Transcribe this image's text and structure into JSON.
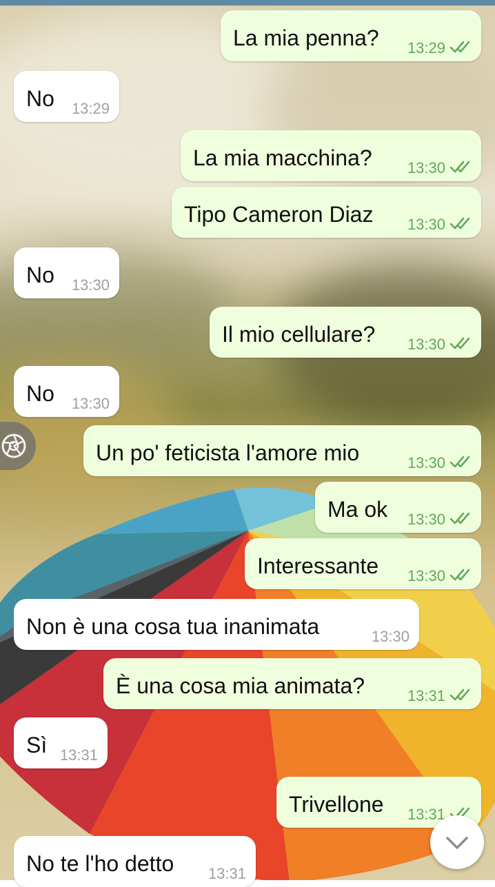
{
  "chat": {
    "background_image": "rainbow-umbrella-wallpaper",
    "messages": [
      {
        "direction": "out",
        "text": "La mia penna?",
        "time": "13:29",
        "status": "read"
      },
      {
        "direction": "in",
        "text": "No",
        "time": "13:29"
      },
      {
        "direction": "out",
        "text": "La mia macchina?",
        "time": "13:30",
        "status": "read"
      },
      {
        "direction": "out",
        "text": "Tipo Cameron Diaz",
        "time": "13:30",
        "status": "read"
      },
      {
        "direction": "in",
        "text": "No",
        "time": "13:30"
      },
      {
        "direction": "out",
        "text": "Il mio cellulare?",
        "time": "13:30",
        "status": "read"
      },
      {
        "direction": "in",
        "text": "No",
        "time": "13:30"
      },
      {
        "direction": "out",
        "text": "Un po' feticista l'amore mio",
        "time": "13:30",
        "status": "read"
      },
      {
        "direction": "out",
        "text": "Ma ok",
        "time": "13:30",
        "status": "read"
      },
      {
        "direction": "out",
        "text": "Interessante",
        "time": "13:30",
        "status": "read"
      },
      {
        "direction": "in",
        "text": "Non è una cosa tua inanimata",
        "time": "13:30"
      },
      {
        "direction": "out",
        "text": "È una cosa mia animata?",
        "time": "13:31",
        "status": "read"
      },
      {
        "direction": "in",
        "text": "Sì",
        "time": "13:31"
      },
      {
        "direction": "out",
        "text": "Trivellone",
        "time": "13:31",
        "status": "read"
      },
      {
        "direction": "in",
        "text": "No te l'ho detto",
        "time": "13:31"
      }
    ]
  },
  "controls": {
    "camera_icon": "camera-aperture-icon",
    "scroll_down_icon": "chevron-down-icon"
  },
  "colors": {
    "outgoing_bubble": "#efffde",
    "incoming_bubble": "#ffffff",
    "read_check": "#5fa85a",
    "incoming_time": "#9aa0a6",
    "top_bar": "#5e8aa4"
  }
}
